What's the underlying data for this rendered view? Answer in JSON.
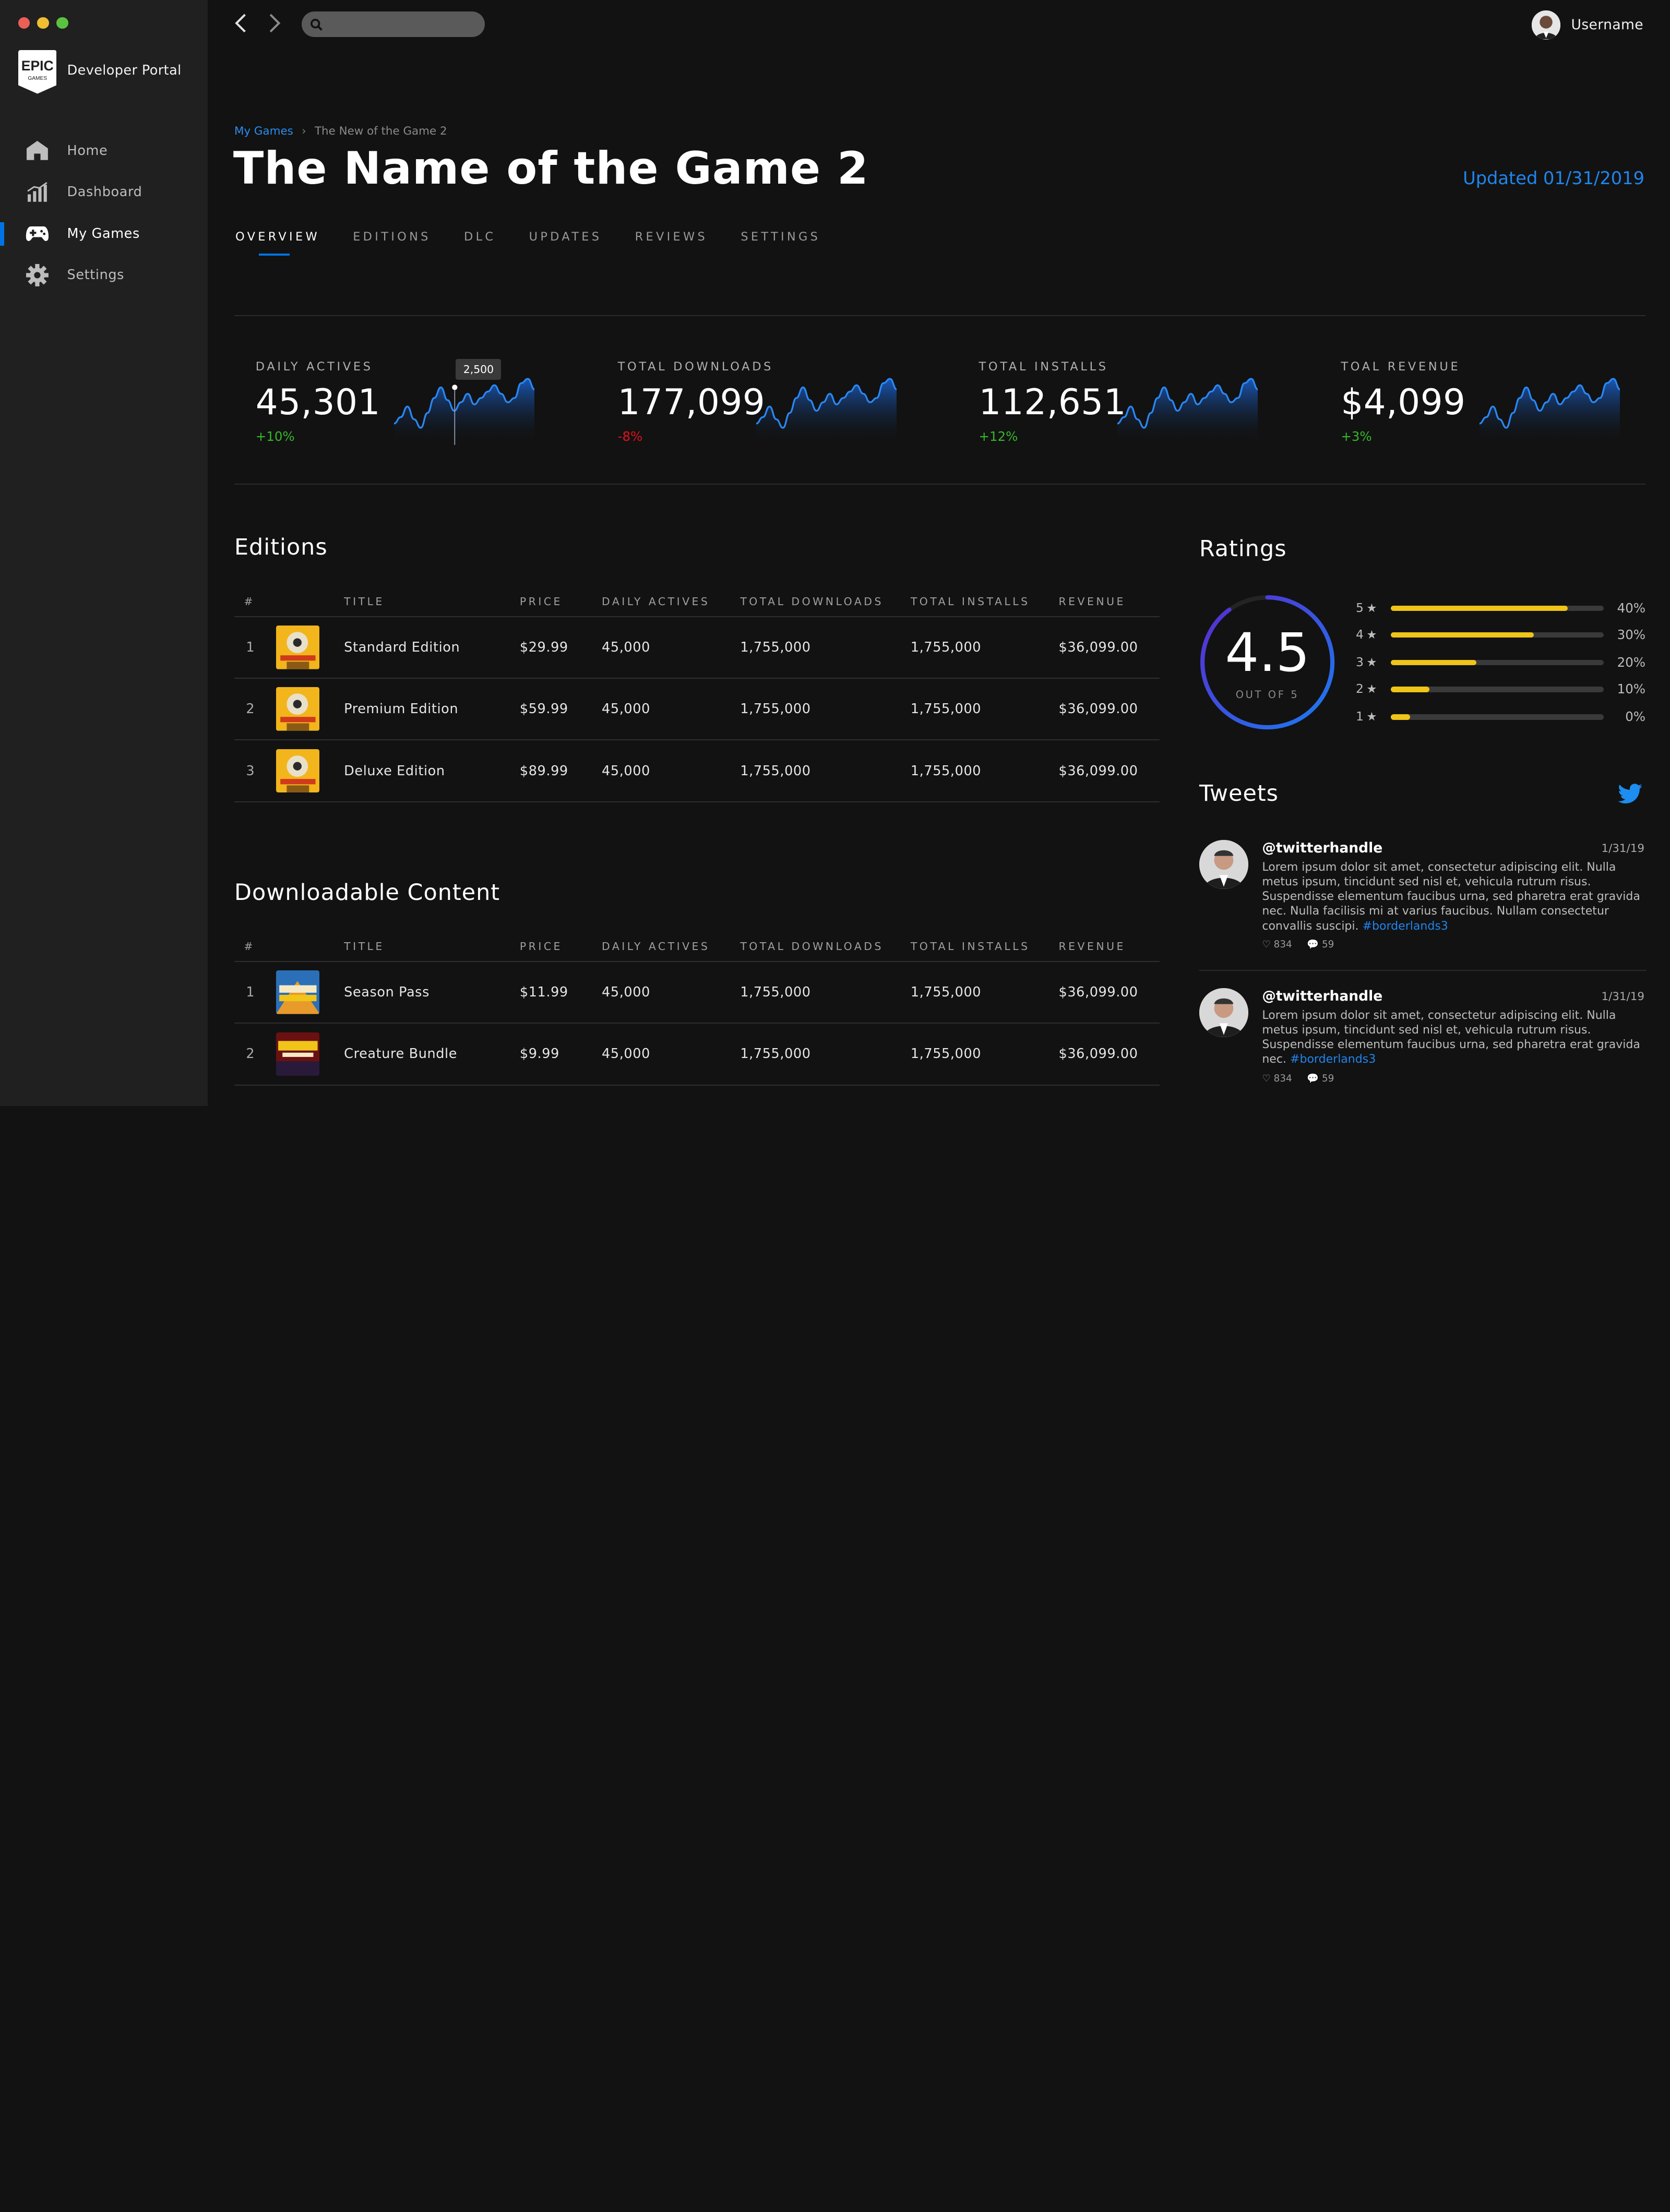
{
  "app": {
    "window_dots": [
      "#ec5f57",
      "#f0be32",
      "#5ac241"
    ],
    "portal_name": "Developer Portal",
    "logo_text": [
      "EPIC",
      "GAMES"
    ]
  },
  "sidebar": {
    "items": [
      {
        "label": "Home",
        "icon": "home-icon"
      },
      {
        "label": "Dashboard",
        "icon": "chart-icon"
      },
      {
        "label": "My Games",
        "icon": "gamepad-icon",
        "active": true
      },
      {
        "label": "Settings",
        "icon": "gear-icon"
      }
    ]
  },
  "topbar": {
    "search_placeholder": "",
    "username": "Username"
  },
  "header": {
    "breadcrumb_root": "My Games",
    "breadcrumb_sep": "›",
    "breadcrumb_current": "The New of the Game 2",
    "title": "The Name of the Game 2",
    "updated": "Updated 01/31/2019",
    "tabs": [
      "OVERVIEW",
      "EDITIONS",
      "DLC",
      "UPDATES",
      "REVIEWS",
      "SETTINGS"
    ]
  },
  "stats": [
    {
      "label": "DAILY ACTIVES",
      "value": "45,301",
      "change": "+10%",
      "trend": "up"
    },
    {
      "label": "TOTAL DOWNLOADS",
      "value": "177,099",
      "change": "-8%",
      "trend": "down"
    },
    {
      "label": "TOTAL INSTALLS",
      "value": "112,651",
      "change": "+12%",
      "trend": "up"
    },
    {
      "label": "TOAL REVENUE",
      "value": "$4,099",
      "change": "+3%",
      "trend": "up"
    }
  ],
  "sparkline_tooltip": "2,500",
  "colors": {
    "accent": "#0074e4",
    "positive": "#35b72a",
    "negative": "#e0101c",
    "star": "#f0c419"
  },
  "editions": {
    "title": "Editions",
    "columns": [
      "#",
      "TITLE",
      "PRICE",
      "DAILY ACTIVES",
      "TOTAL DOWNLOADS",
      "TOTAL INSTALLS",
      "REVENUE"
    ],
    "rows": [
      [
        "1",
        "Standard Edition",
        "$29.99",
        "45,000",
        "1,755,000",
        "1,755,000",
        "$36,099.00"
      ],
      [
        "2",
        "Premium Edition",
        "$59.99",
        "45,000",
        "1,755,000",
        "1,755,000",
        "$36,099.00"
      ],
      [
        "3",
        "Deluxe Edition",
        "$89.99",
        "45,000",
        "1,755,000",
        "1,755,000",
        "$36,099.00"
      ]
    ]
  },
  "dlc": {
    "title": "Downloadable Content",
    "columns": [
      "#",
      "TITLE",
      "PRICE",
      "DAILY ACTIVES",
      "TOTAL DOWNLOADS",
      "TOTAL INSTALLS",
      "REVENUE"
    ],
    "rows": [
      [
        "1",
        "Season Pass",
        "$11.99",
        "45,000",
        "1,755,000",
        "1,755,000",
        "$36,099.00"
      ],
      [
        "2",
        "Creature Bundle",
        "$9.99",
        "45,000",
        "1,755,000",
        "1,755,000",
        "$36,099.00"
      ]
    ]
  },
  "ratings": {
    "title": "Ratings",
    "score": "4.5",
    "out_of": "OUT OF 5",
    "score_fraction": 0.9,
    "rows": [
      {
        "stars": "5",
        "pct": "40%",
        "fill": 0.83
      },
      {
        "stars": "4",
        "pct": "30%",
        "fill": 0.67
      },
      {
        "stars": "3",
        "pct": "20%",
        "fill": 0.4
      },
      {
        "stars": "2",
        "pct": "10%",
        "fill": 0.18
      },
      {
        "stars": "1",
        "pct": "0%",
        "fill": 0.09
      }
    ]
  },
  "tweets": {
    "title": "Tweets",
    "icon": "twitter-icon",
    "items": [
      {
        "handle": "@twitterhandle",
        "date": "1/31/19",
        "text": "Lorem ipsum dolor sit amet, consectetur adipiscing elit. Nulla metus ipsum, tincidunt sed nisl et, vehicula rutrum risus. Suspendisse elementum faucibus urna, sed pharetra erat gravida nec. Nulla facilisis mi at varius faucibus. Nullam consectetur convallis suscipi.",
        "hashtag": "#borderlands3",
        "likes": "834",
        "comments": "59"
      },
      {
        "handle": "@twitterhandle",
        "date": "1/31/19",
        "text": "Lorem ipsum dolor sit amet, consectetur adipiscing elit. Nulla metus ipsum, tincidunt sed nisl et, vehicula rutrum risus. Suspendisse elementum faucibus urna, sed pharetra erat gravida nec.",
        "hashtag": "#borderlands3",
        "likes": "834",
        "comments": "59"
      }
    ]
  }
}
